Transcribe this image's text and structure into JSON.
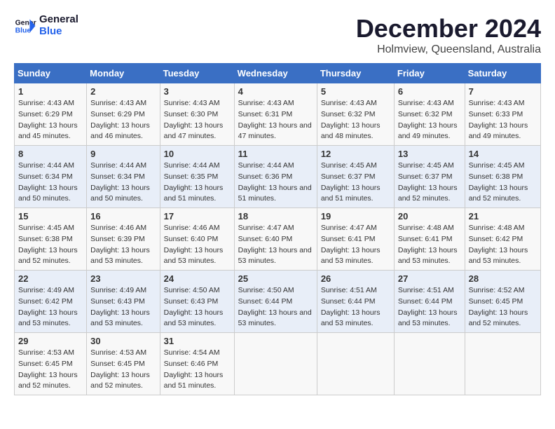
{
  "logo": {
    "line1": "General",
    "line2": "Blue"
  },
  "title": "December 2024",
  "location": "Holmview, Queensland, Australia",
  "headers": [
    "Sunday",
    "Monday",
    "Tuesday",
    "Wednesday",
    "Thursday",
    "Friday",
    "Saturday"
  ],
  "weeks": [
    [
      {
        "day": "1",
        "sunrise": "4:43 AM",
        "sunset": "6:29 PM",
        "daylight": "13 hours and 45 minutes."
      },
      {
        "day": "2",
        "sunrise": "4:43 AM",
        "sunset": "6:29 PM",
        "daylight": "13 hours and 46 minutes."
      },
      {
        "day": "3",
        "sunrise": "4:43 AM",
        "sunset": "6:30 PM",
        "daylight": "13 hours and 47 minutes."
      },
      {
        "day": "4",
        "sunrise": "4:43 AM",
        "sunset": "6:31 PM",
        "daylight": "13 hours and 47 minutes."
      },
      {
        "day": "5",
        "sunrise": "4:43 AM",
        "sunset": "6:32 PM",
        "daylight": "13 hours and 48 minutes."
      },
      {
        "day": "6",
        "sunrise": "4:43 AM",
        "sunset": "6:32 PM",
        "daylight": "13 hours and 49 minutes."
      },
      {
        "day": "7",
        "sunrise": "4:43 AM",
        "sunset": "6:33 PM",
        "daylight": "13 hours and 49 minutes."
      }
    ],
    [
      {
        "day": "8",
        "sunrise": "4:44 AM",
        "sunset": "6:34 PM",
        "daylight": "13 hours and 50 minutes."
      },
      {
        "day": "9",
        "sunrise": "4:44 AM",
        "sunset": "6:34 PM",
        "daylight": "13 hours and 50 minutes."
      },
      {
        "day": "10",
        "sunrise": "4:44 AM",
        "sunset": "6:35 PM",
        "daylight": "13 hours and 51 minutes."
      },
      {
        "day": "11",
        "sunrise": "4:44 AM",
        "sunset": "6:36 PM",
        "daylight": "13 hours and 51 minutes."
      },
      {
        "day": "12",
        "sunrise": "4:45 AM",
        "sunset": "6:37 PM",
        "daylight": "13 hours and 51 minutes."
      },
      {
        "day": "13",
        "sunrise": "4:45 AM",
        "sunset": "6:37 PM",
        "daylight": "13 hours and 52 minutes."
      },
      {
        "day": "14",
        "sunrise": "4:45 AM",
        "sunset": "6:38 PM",
        "daylight": "13 hours and 52 minutes."
      }
    ],
    [
      {
        "day": "15",
        "sunrise": "4:45 AM",
        "sunset": "6:38 PM",
        "daylight": "13 hours and 52 minutes."
      },
      {
        "day": "16",
        "sunrise": "4:46 AM",
        "sunset": "6:39 PM",
        "daylight": "13 hours and 53 minutes."
      },
      {
        "day": "17",
        "sunrise": "4:46 AM",
        "sunset": "6:40 PM",
        "daylight": "13 hours and 53 minutes."
      },
      {
        "day": "18",
        "sunrise": "4:47 AM",
        "sunset": "6:40 PM",
        "daylight": "13 hours and 53 minutes."
      },
      {
        "day": "19",
        "sunrise": "4:47 AM",
        "sunset": "6:41 PM",
        "daylight": "13 hours and 53 minutes."
      },
      {
        "day": "20",
        "sunrise": "4:48 AM",
        "sunset": "6:41 PM",
        "daylight": "13 hours and 53 minutes."
      },
      {
        "day": "21",
        "sunrise": "4:48 AM",
        "sunset": "6:42 PM",
        "daylight": "13 hours and 53 minutes."
      }
    ],
    [
      {
        "day": "22",
        "sunrise": "4:49 AM",
        "sunset": "6:42 PM",
        "daylight": "13 hours and 53 minutes."
      },
      {
        "day": "23",
        "sunrise": "4:49 AM",
        "sunset": "6:43 PM",
        "daylight": "13 hours and 53 minutes."
      },
      {
        "day": "24",
        "sunrise": "4:50 AM",
        "sunset": "6:43 PM",
        "daylight": "13 hours and 53 minutes."
      },
      {
        "day": "25",
        "sunrise": "4:50 AM",
        "sunset": "6:44 PM",
        "daylight": "13 hours and 53 minutes."
      },
      {
        "day": "26",
        "sunrise": "4:51 AM",
        "sunset": "6:44 PM",
        "daylight": "13 hours and 53 minutes."
      },
      {
        "day": "27",
        "sunrise": "4:51 AM",
        "sunset": "6:44 PM",
        "daylight": "13 hours and 53 minutes."
      },
      {
        "day": "28",
        "sunrise": "4:52 AM",
        "sunset": "6:45 PM",
        "daylight": "13 hours and 52 minutes."
      }
    ],
    [
      {
        "day": "29",
        "sunrise": "4:53 AM",
        "sunset": "6:45 PM",
        "daylight": "13 hours and 52 minutes."
      },
      {
        "day": "30",
        "sunrise": "4:53 AM",
        "sunset": "6:45 PM",
        "daylight": "13 hours and 52 minutes."
      },
      {
        "day": "31",
        "sunrise": "4:54 AM",
        "sunset": "6:46 PM",
        "daylight": "13 hours and 51 minutes."
      },
      {
        "day": "",
        "sunrise": "",
        "sunset": "",
        "daylight": ""
      },
      {
        "day": "",
        "sunrise": "",
        "sunset": "",
        "daylight": ""
      },
      {
        "day": "",
        "sunrise": "",
        "sunset": "",
        "daylight": ""
      },
      {
        "day": "",
        "sunrise": "",
        "sunset": "",
        "daylight": ""
      }
    ]
  ]
}
